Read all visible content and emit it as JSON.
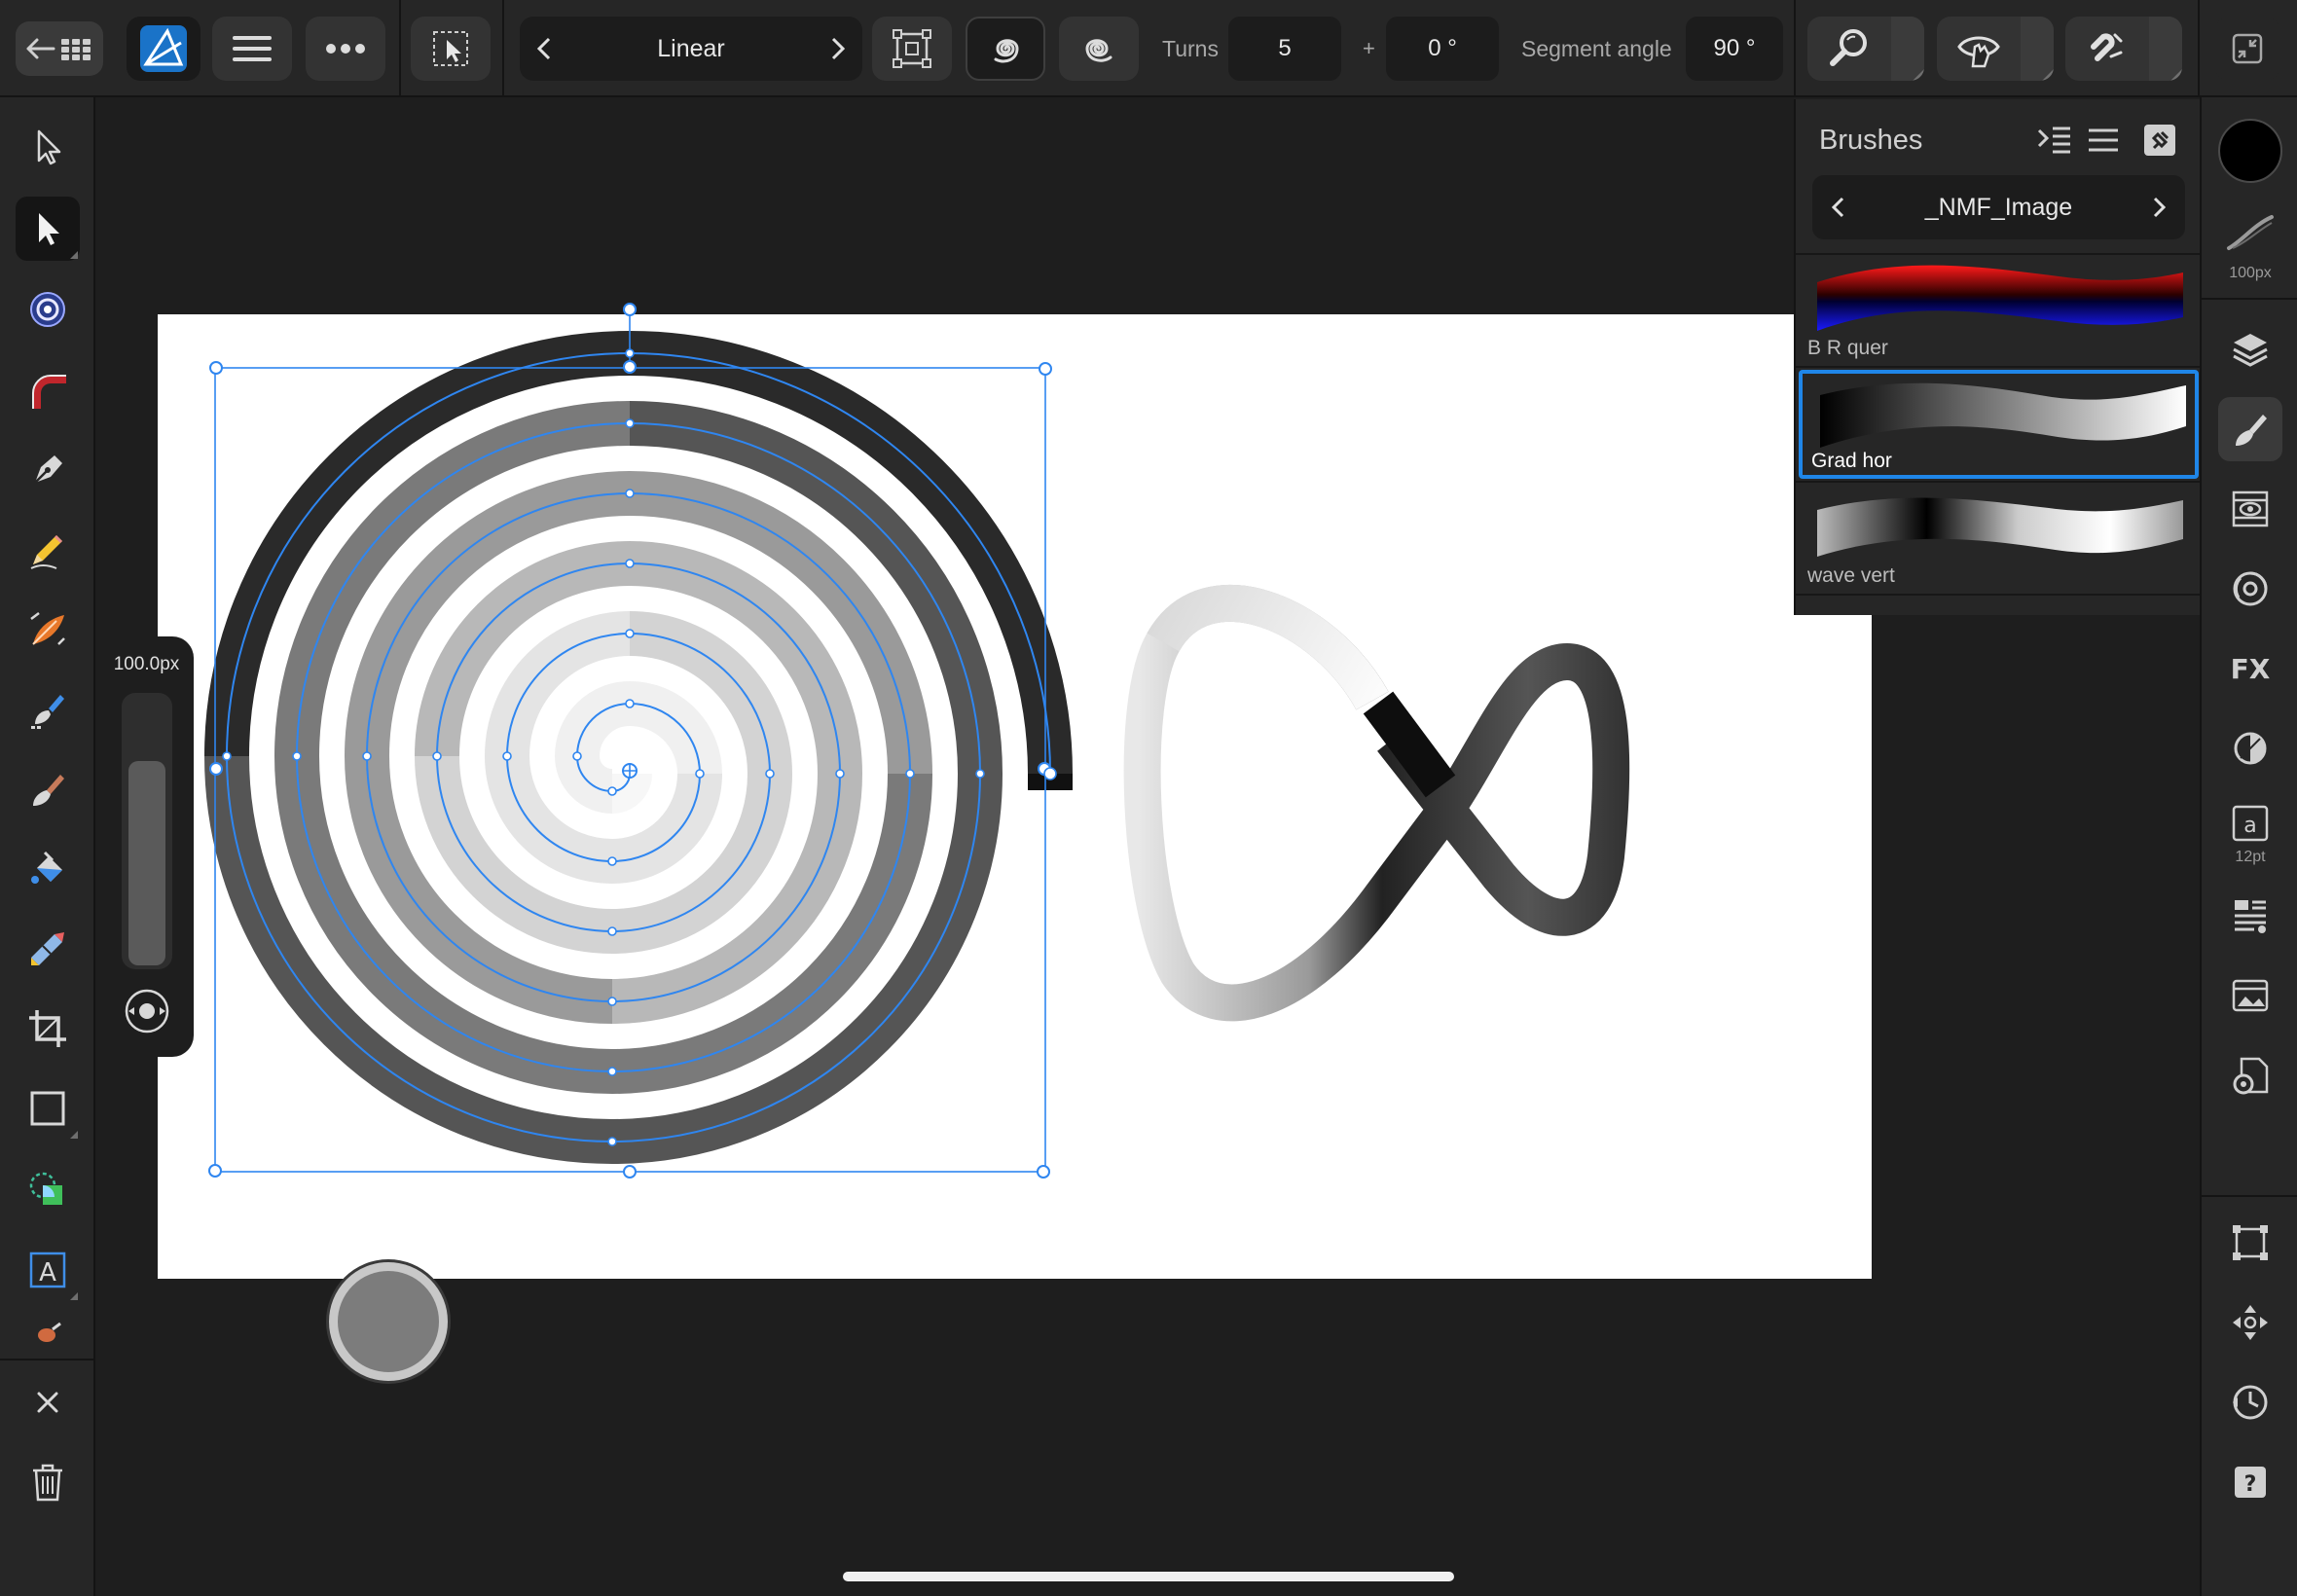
{
  "toolbar": {
    "mode_label": "Linear",
    "turns_label": "Turns",
    "turns_value": "5",
    "plus_label": "+",
    "offset_value": "0 °",
    "segment_angle_label": "Segment angle",
    "segment_angle_value": "90 °"
  },
  "size_popup": {
    "value": "100.0px",
    "level": 0.76
  },
  "brushes_panel": {
    "title": "Brushes",
    "category": "_NMF_Image",
    "brushes": [
      {
        "name": "B R quer",
        "selected": false
      },
      {
        "name": "Grad hor",
        "selected": true
      },
      {
        "name": "wave vert",
        "selected": false
      }
    ]
  },
  "studio": {
    "brush_size_label": "100px",
    "text_size_label": "12pt",
    "primary_color": "#000000"
  },
  "colors": {
    "accent": "#1f86e8",
    "selection": "#2f86f0",
    "toolbar_bg": "#262626",
    "canvas_bg": "#1e1e1e",
    "document_bg": "#ffffff",
    "current_color": "#7c7c7c"
  },
  "icons": [
    "back-grid-icon",
    "affinity-designer-logo-icon",
    "hamburger-menu-icon",
    "more-icon",
    "select-transform-icon",
    "chevron-left-icon",
    "chevron-right-icon",
    "transform-box-icon",
    "spiral-clockwise-icon",
    "spiral-counterclockwise-icon",
    "snap-search-icon",
    "eye-hand-icon",
    "magnet-icon",
    "collapse-icon",
    "move-tool-icon",
    "node-tool-icon",
    "point-transform-icon",
    "corner-tool-icon",
    "pen-tool-icon",
    "pencil-tool-icon",
    "vector-brush-icon",
    "pixel-brush-icon",
    "paint-brush-icon",
    "fill-tool-icon",
    "transparency-tool-icon",
    "crop-icon",
    "rectangle-icon",
    "shape-builder-icon",
    "text-tool-icon",
    "close-icon",
    "trash-icon",
    "layers-icon",
    "brushes-studio-icon",
    "stock-icon",
    "symbols-icon",
    "fx-icon",
    "adjustment-icon",
    "character-icon",
    "paragraph-icon",
    "assets-icon",
    "document-settings-icon",
    "transform-panel-icon",
    "navigator-icon",
    "history-icon",
    "help-icon"
  ]
}
